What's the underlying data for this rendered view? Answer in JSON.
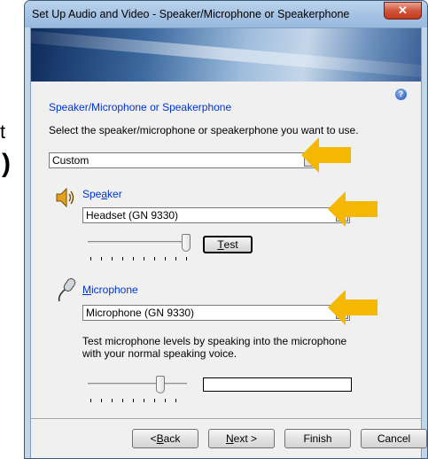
{
  "background_fragments": {
    "t_char": "t",
    "paren_char": ")"
  },
  "window": {
    "title": "Set Up Audio and Video - Speaker/Microphone or Speakerphone",
    "close_glyph": "✕",
    "help_glyph": "?"
  },
  "page": {
    "heading": "Speaker/Microphone or Speakerphone",
    "instruction": "Select the speaker/microphone or speakerphone you want to use."
  },
  "device_preset": {
    "selected": "Custom"
  },
  "speaker": {
    "label_prefix": "Spe",
    "label_underlined": "a",
    "label_suffix": "ker",
    "selected_device": "Headset (GN 9330)",
    "volume_level_fraction": 1.0,
    "test_button_label_underlined": "T",
    "test_button_label_rest": "est"
  },
  "microphone": {
    "label_underlined": "M",
    "label_rest": "icrophone",
    "selected_device": "Microphone (GN 9330)",
    "description": "Test microphone levels by speaking into the microphone with your normal speaking voice.",
    "input_level_fraction": 0.75,
    "meter_level_fraction": 0.0
  },
  "footer": {
    "back": {
      "prefix": "< ",
      "underlined": "B",
      "rest": "ack"
    },
    "next": {
      "underlined": "N",
      "rest": "ext >"
    },
    "finish": "Finish",
    "cancel": "Cancel"
  },
  "colors": {
    "accent_text": "#0033cc",
    "arrow": "#f5b800",
    "close_button": "#c8432a"
  },
  "annotations": {
    "arrows_count": 3
  }
}
